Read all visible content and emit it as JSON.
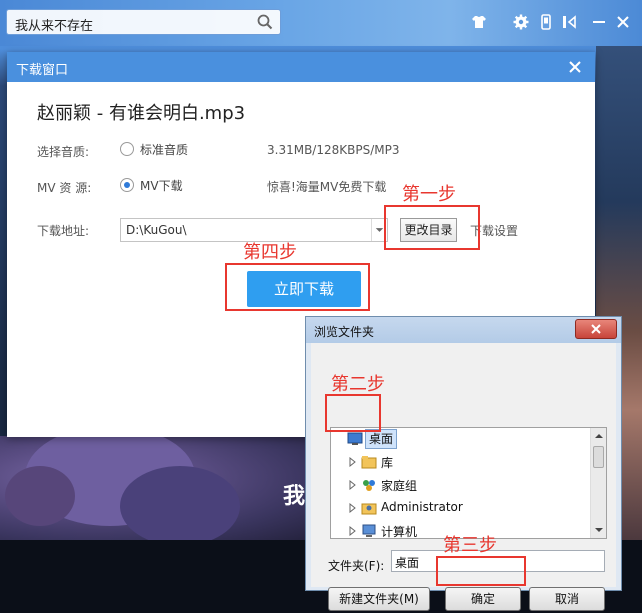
{
  "app": {
    "search_text": "我从来不存在",
    "video_caption": "我"
  },
  "dialog": {
    "title": "下载窗口",
    "song_title": "赵丽颖 - 有谁会明白.mp3",
    "quality_label": "选择音质:",
    "quality_option": "标准音质",
    "quality_info": "3.31MB/128KBPS/MP3",
    "mv_label": "MV 资 源:",
    "mv_option": "MV下载",
    "mv_info": "惊喜!海量MV免费下载",
    "path_label": "下载地址:",
    "path_value": "D:\\KuGou\\",
    "change_dir_button": "更改目录",
    "settings_link": "下载设置",
    "download_button": "立即下载"
  },
  "annotations": {
    "step1": "第一步",
    "step2": "第二步",
    "step3": "第三步",
    "step4": "第四步"
  },
  "browse_dialog": {
    "title": "浏览文件夹",
    "tree_items": [
      "桌面",
      "库",
      "家庭组",
      "Administrator",
      "计算机"
    ],
    "folder_label": "文件夹(F):",
    "folder_value": "桌面",
    "new_folder_button": "新建文件夹(M)",
    "ok_button": "确定",
    "cancel_button": "取消"
  },
  "colors": {
    "header_blue": "#4a90de",
    "download_blue": "#2f9ef0",
    "annotation_red": "#e8372f"
  }
}
